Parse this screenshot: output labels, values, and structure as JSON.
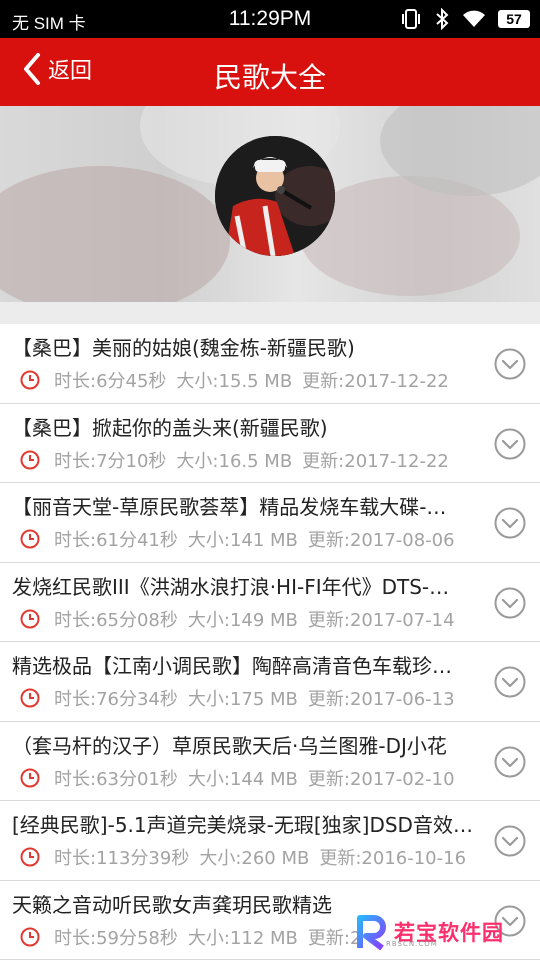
{
  "status_bar": {
    "carrier": "无 SIM 卡",
    "time": "11:29PM",
    "battery": "57",
    "icons": [
      "vibrate-icon",
      "bluetooth-icon",
      "wifi-icon",
      "battery-icon"
    ]
  },
  "header": {
    "back_label": "返回",
    "title": "民歌大全",
    "background": "#d8110f"
  },
  "songs": [
    {
      "title": "【桑巴】美丽的姑娘(魏金栋-新疆民歌)",
      "duration": "时长:6分45秒",
      "size": "大小:15.5 MB",
      "updated": "更新:2017-12-22"
    },
    {
      "title": "【桑巴】掀起你的盖头来(新疆民歌)",
      "duration": "时长:7分10秒",
      "size": "大小:16.5 MB",
      "updated": "更新:2017-12-22"
    },
    {
      "title": "【丽音天堂-草原民歌荟萃】精品发烧车载大碟-…",
      "duration": "时长:61分41秒",
      "size": "大小:141 MB",
      "updated": "更新:2017-08-06"
    },
    {
      "title": "发烧红民歌III《洪湖水浪打浪·HI-FI年代》DTS-…",
      "duration": "时长:65分08秒",
      "size": "大小:149 MB",
      "updated": "更新:2017-07-14"
    },
    {
      "title": "精选极品【江南小调民歌】陶醉高清音色车载珍…",
      "duration": "时长:76分34秒",
      "size": "大小:175 MB",
      "updated": "更新:2017-06-13"
    },
    {
      "title": "（套马杆的汉子）草原民歌天后·乌兰图雅-DJ小花",
      "duration": "时长:63分01秒",
      "size": "大小:144 MB",
      "updated": "更新:2017-02-10"
    },
    {
      "title": "[经典民歌]-5.1声道完美烧录-无瑕[独家]DSD音效…",
      "duration": "时长:113分39秒",
      "size": "大小:260 MB",
      "updated": "更新:2016-10-16"
    },
    {
      "title": "天籁之音动听民歌女声龚玥民歌精选",
      "duration": "时长:59分58秒",
      "size": "大小:112 MB",
      "updated": "更新:2"
    }
  ],
  "watermark": {
    "text": "若宝软件园",
    "sub": "RBSCN.COM"
  },
  "colors": {
    "accent": "#d8110f",
    "meta_text": "#a3a3a3",
    "icon_red": "#e03a30"
  }
}
